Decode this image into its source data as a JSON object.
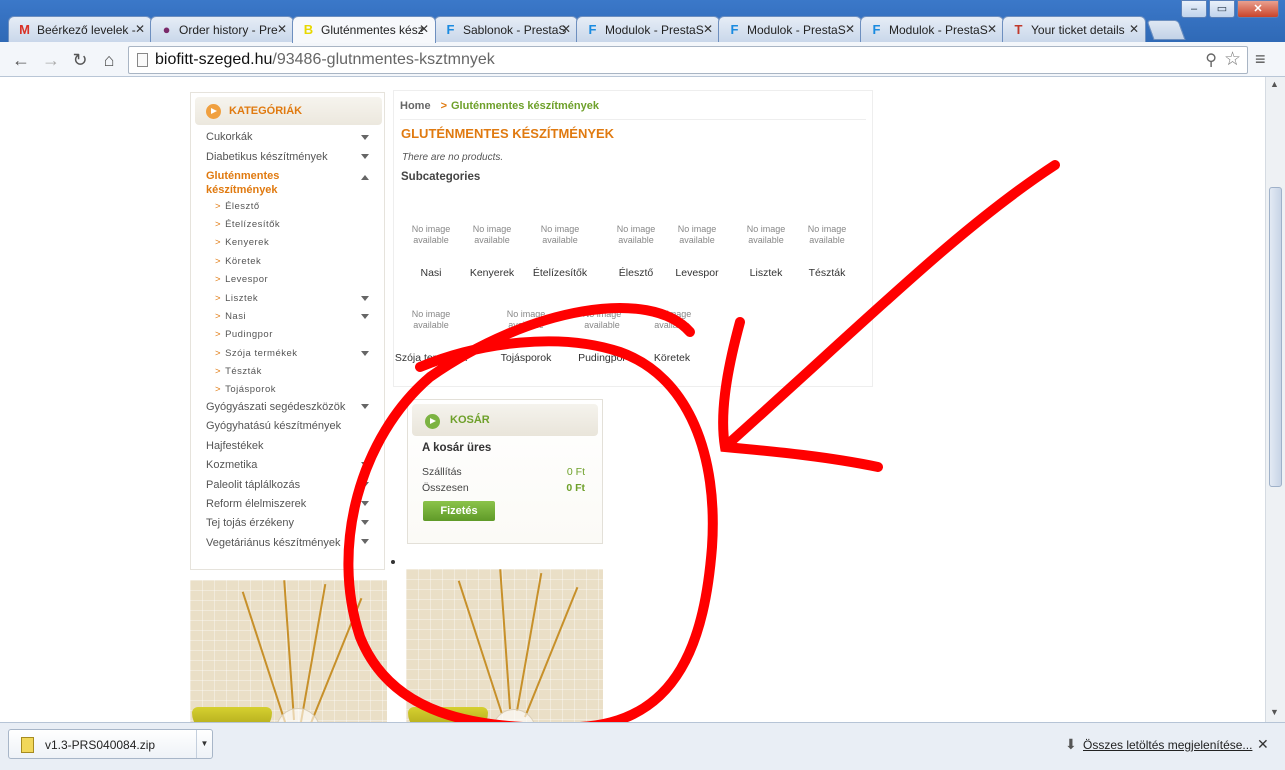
{
  "browser": {
    "tabs": [
      {
        "title": "Beérkező levelek -",
        "icon": "gmail-icon",
        "glyph": "M",
        "color": "#d93025"
      },
      {
        "title": "Order history - Pre",
        "icon": "prestashop-icon",
        "glyph": "●",
        "color": "#7a2a6a"
      },
      {
        "title": "Gluténmentes kész",
        "icon": "biofitt-icon",
        "glyph": "B",
        "color": "#e8d800"
      },
      {
        "title": "Sablonok - PrestaS",
        "icon": "f-icon",
        "glyph": "F",
        "color": "#1a8be0"
      },
      {
        "title": "Modulok - PrestaS",
        "icon": "f-icon",
        "glyph": "F",
        "color": "#1a8be0"
      },
      {
        "title": "Modulok - PrestaS",
        "icon": "f-icon",
        "glyph": "F",
        "color": "#1a8be0"
      },
      {
        "title": "Modulok - PrestaS",
        "icon": "f-icon",
        "glyph": "F",
        "color": "#1a8be0"
      },
      {
        "title": "Your ticket details",
        "icon": "ticket-icon",
        "glyph": "T",
        "color": "#c0392b"
      }
    ],
    "url_host": "biofitt-szeged.hu",
    "url_path": "/93486-glutnmentes-ksztmnyek"
  },
  "sidebar": {
    "title": "KATEGÓRIÁK",
    "categories": [
      {
        "label": "Cukorkák"
      },
      {
        "label": "Diabetikus készítmények"
      },
      {
        "label": "Gluténmentes"
      },
      {
        "label": "készítmények"
      }
    ],
    "subcategories": [
      "Élesztő",
      "Ételízesítők",
      "Kenyerek",
      "Köretek",
      "Levespor",
      "Lisztek",
      "Nasi",
      "Pudingpor",
      "Szója termékek",
      "Tészták",
      "Tojásporok"
    ],
    "more_categories": [
      "Gyógyászati segédeszközök",
      "Gyógyhatású készítmények",
      "Hajfestékek",
      "Kozmetika",
      "Paleolit táplálkozás",
      "Reform élelmiszerek",
      "Tej tojás érzékeny",
      "Vegetáriánus készítmények"
    ]
  },
  "main": {
    "breadcrumb_home": "Home",
    "breadcrumb_sep": ">",
    "breadcrumb_current": "Gluténmentes készítmények",
    "title": "GLUTÉNMENTES KÉSZÍTMÉNYEK",
    "no_products": "There are no products.",
    "subcategories_title": "Subcategories",
    "no_image_line1": "No image",
    "no_image_line2": "available",
    "subcats_row1": [
      "Nasi",
      "Kenyerek",
      "Ételízesítők",
      "Élesztő",
      "Levespor",
      "Lisztek",
      "Tészták"
    ],
    "subcats_row2": [
      "Szója termékek",
      "Tojásporok",
      "Pudingpor",
      "Köretek"
    ]
  },
  "cart": {
    "title": "KOSÁR",
    "empty": "A kosár üres",
    "shipping_label": "Szállítás",
    "shipping_value": "0 Ft",
    "total_label": "Összesen",
    "total_value": "0 Ft",
    "checkout": "Fizetés"
  },
  "downloads": {
    "file": "v1.3-PRS040084.zip",
    "show_all": "Összes letöltés megjelenítése..."
  },
  "colors": {
    "accent_orange": "#e07a10",
    "accent_green": "#6ea02a",
    "annotation_red": "#ff0000"
  }
}
